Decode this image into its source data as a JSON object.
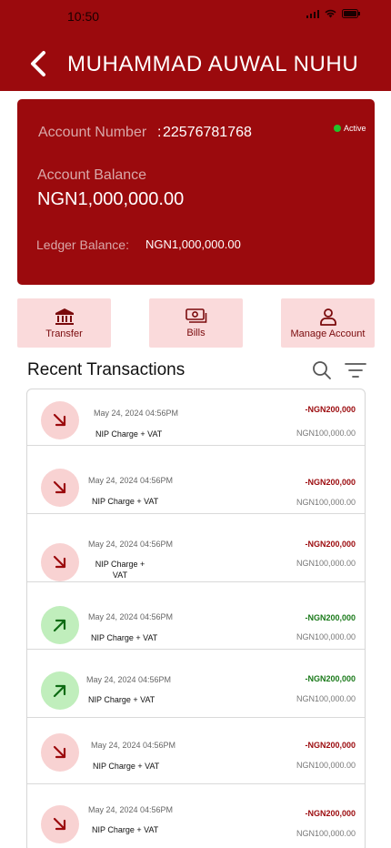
{
  "status_bar": {
    "time": "10:50"
  },
  "header": {
    "title": "MUHAMMAD AUWAL NUHU"
  },
  "account": {
    "number_label": "Account Number",
    "number_sep": ":",
    "number": "22576781768",
    "status": "Active",
    "balance_label": "Account Balance",
    "balance": "NGN1,000,000.00",
    "ledger_label": "Ledger Balance:",
    "ledger": "NGN1,000,000.00"
  },
  "actions": [
    {
      "label": "Transfer",
      "icon": "bank-icon"
    },
    {
      "label": "Bills",
      "icon": "money-icon"
    },
    {
      "label": "Manage Account",
      "icon": "user-icon"
    }
  ],
  "recent": {
    "title": "Recent Transactions"
  },
  "transactions": [
    {
      "type": "debit",
      "date": "May 24, 2024 04:56PM",
      "desc": "NIP Charge + VAT",
      "amount": "-NGN200,000",
      "balance": "NGN100,000.00"
    },
    {
      "type": "debit",
      "date": "May 24, 2024 04:56PM",
      "desc": "NIP Charge + VAT",
      "amount": "-NGN200,000",
      "balance": "NGN100,000.00"
    },
    {
      "type": "debit",
      "date": "May 24, 2024 04:56PM",
      "desc": "NIP Charge + VAT",
      "amount": "-NGN200,000",
      "balance": "NGN100,000.00"
    },
    {
      "type": "credit",
      "date": "May 24, 2024 04:56PM",
      "desc": "NIP Charge + VAT",
      "amount": "-NGN200,000",
      "balance": "NGN100,000.00"
    },
    {
      "type": "credit",
      "date": "May 24, 2024 04:56PM",
      "desc": "NIP Charge + VAT",
      "amount": "-NGN200,000",
      "balance": "NGN100,000.00"
    },
    {
      "type": "debit",
      "date": "May 24, 2024 04:56PM",
      "desc": "NIP Charge + VAT",
      "amount": "-NGN200,000",
      "balance": "NGN100,000.00"
    },
    {
      "type": "debit",
      "date": "May 24, 2024 04:56PM",
      "desc": "NIP Charge + VAT",
      "amount": "-NGN200,000",
      "balance": "NGN100,000.00"
    }
  ],
  "colors": {
    "brand": "#9b0a0d",
    "debit_bg": "#f8d2d2",
    "credit_bg": "#c0eebc",
    "action_bg": "#fadadb"
  }
}
